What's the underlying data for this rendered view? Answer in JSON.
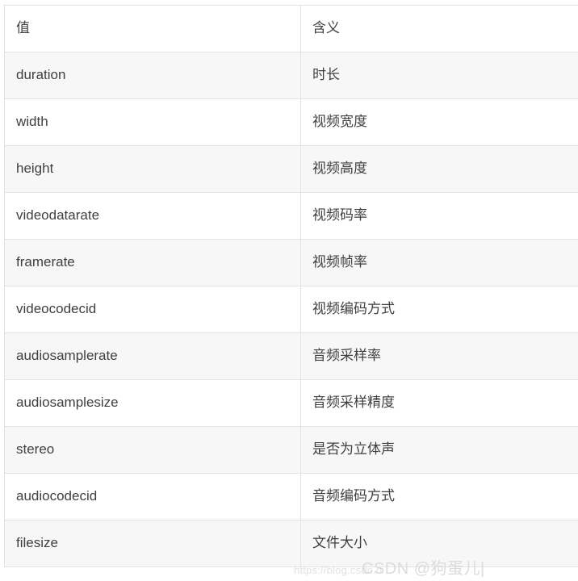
{
  "table": {
    "columns": [
      "值",
      "含义"
    ],
    "rows": [
      {
        "value": "duration",
        "meaning": "时长"
      },
      {
        "value": "width",
        "meaning": "视频宽度"
      },
      {
        "value": "height",
        "meaning": "视频高度"
      },
      {
        "value": "videodatarate",
        "meaning": "视频码率"
      },
      {
        "value": "framerate",
        "meaning": "视频帧率"
      },
      {
        "value": "videocodecid",
        "meaning": "视频编码方式"
      },
      {
        "value": "audiosamplerate",
        "meaning": "音频采样率"
      },
      {
        "value": "audiosamplesize",
        "meaning": "音频采样精度"
      },
      {
        "value": "stereo",
        "meaning": "是否为立体声"
      },
      {
        "value": "audiocodecid",
        "meaning": "音频编码方式"
      },
      {
        "value": "filesize",
        "meaning": "文件大小"
      }
    ]
  },
  "watermark": {
    "url": "https://blog.csdn.n",
    "brand": "CSDN @狗蛋儿|"
  },
  "colors": {
    "text": "#3f3f3f",
    "border": "#e3e3e3",
    "row_alt_bg": "#f7f7f7",
    "row_bg": "#ffffff",
    "watermark": "#dcdcdc"
  }
}
